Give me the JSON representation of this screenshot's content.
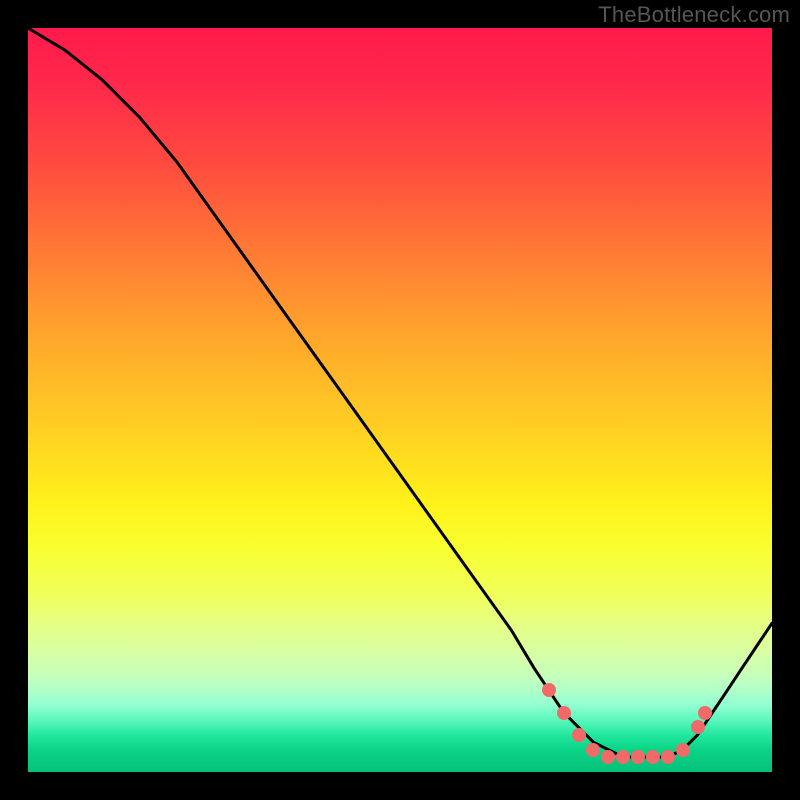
{
  "watermark": "TheBottleneck.com",
  "colors": {
    "frame_background": "#000000",
    "curve_stroke": "#000000",
    "dot_fill": "#f06a6a",
    "watermark_color": "#555555"
  },
  "chart_data": {
    "type": "line",
    "title": "",
    "xlabel": "",
    "ylabel": "",
    "xlim": [
      0,
      100
    ],
    "ylim": [
      0,
      100
    ],
    "grid": false,
    "legend": false,
    "background": "vertical_gradient_red_to_green",
    "series": [
      {
        "name": "bottleneck-curve",
        "x": [
          0,
          5,
          10,
          15,
          20,
          25,
          30,
          35,
          40,
          45,
          50,
          55,
          60,
          65,
          68,
          70,
          72,
          74,
          76,
          78,
          80,
          82,
          84,
          86,
          88,
          90,
          92,
          94,
          96,
          98,
          100
        ],
        "y": [
          100,
          97,
          93,
          88,
          82,
          75,
          68,
          61,
          54,
          47,
          40,
          33,
          26,
          19,
          14,
          11,
          8,
          6,
          4,
          3,
          2,
          2,
          2,
          2,
          3,
          5,
          8,
          11,
          14,
          17,
          20
        ]
      }
    ],
    "markers": [
      {
        "x": 70,
        "y": 11
      },
      {
        "x": 72,
        "y": 8
      },
      {
        "x": 74,
        "y": 5
      },
      {
        "x": 76,
        "y": 3
      },
      {
        "x": 78,
        "y": 2
      },
      {
        "x": 80,
        "y": 2
      },
      {
        "x": 82,
        "y": 2
      },
      {
        "x": 84,
        "y": 2
      },
      {
        "x": 86,
        "y": 2
      },
      {
        "x": 88,
        "y": 3
      },
      {
        "x": 90,
        "y": 6
      },
      {
        "x": 91,
        "y": 8
      }
    ]
  }
}
